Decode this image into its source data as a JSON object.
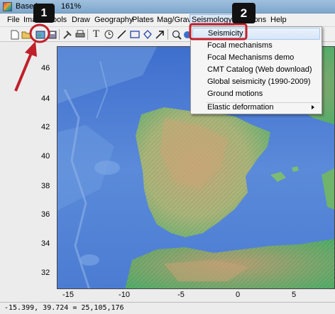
{
  "window": {
    "title": "Base i",
    "zoom": "161%"
  },
  "menubar": {
    "items": [
      {
        "label": "File",
        "name": "menu-file"
      },
      {
        "label": "Ima",
        "name": "menu-image"
      },
      {
        "label": "ools",
        "name": "menu-tools"
      },
      {
        "label": "Draw",
        "name": "menu-draw"
      },
      {
        "label": "Geography",
        "name": "menu-geography"
      },
      {
        "label": "Plates",
        "name": "menu-plates"
      },
      {
        "label": "Mag/Grav",
        "name": "menu-mag-grav"
      },
      {
        "label": "Seismology",
        "name": "menu-seismology"
      },
      {
        "label": "ions",
        "name": "menu-options"
      },
      {
        "label": "Help",
        "name": "menu-help"
      }
    ]
  },
  "toolbar": {
    "tools": [
      "new-file-icon",
      "open-folder-icon",
      "image-import-icon",
      "save-icon",
      "hammer-wrench-icon",
      "print-icon",
      "text-tool-icon",
      "clock-tool-icon",
      "line-tool-icon",
      "rectangle-tool-icon",
      "polygon-tool-icon",
      "arrow-tool-icon",
      "zoom-icon"
    ],
    "text_tool_glyph": "T"
  },
  "seismology_menu": {
    "items": [
      {
        "label": "Seismicity",
        "highlighted": true
      },
      {
        "label": "Focal mechanisms"
      },
      {
        "label": "Focal Mechanisms demo"
      },
      {
        "label": "CMT Catalog (Web download)"
      },
      {
        "label": "Global seismicity (1990-2009)"
      },
      {
        "label": "Ground motions"
      },
      {
        "label": "Elastic deformation",
        "submenu": true
      }
    ]
  },
  "map": {
    "y_ticks": [
      "46",
      "44",
      "42",
      "40",
      "38",
      "36",
      "34",
      "32"
    ],
    "x_ticks": [
      "-15",
      "-10",
      "-5",
      "0",
      "5"
    ]
  },
  "status": {
    "coords": "-15.399, 39.724 =   25,105,176"
  },
  "callouts": [
    {
      "number": "1"
    },
    {
      "number": "2"
    }
  ],
  "colors": {
    "annotation_red": "#c0202a",
    "menu_highlight": "#d7e6f7"
  }
}
